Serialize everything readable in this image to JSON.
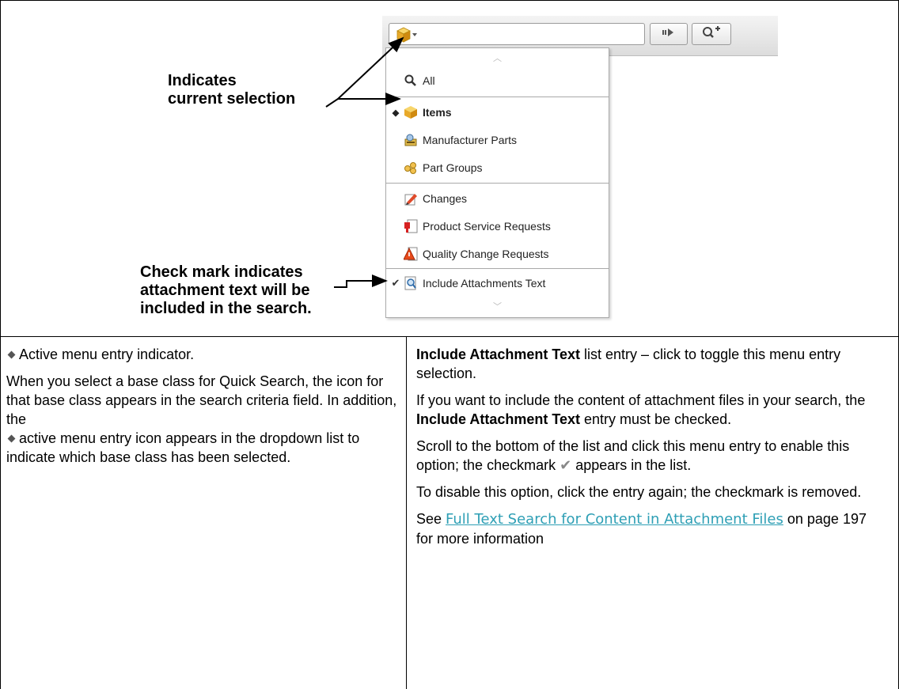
{
  "toolbar": {
    "class_selector_icon": "cube-icon",
    "go_icon": "arrow-right-icon",
    "advanced_search_icon": "search-plus-icon"
  },
  "dropdown": {
    "scroll_up": "^",
    "scroll_down": "v",
    "items": [
      {
        "label": "All",
        "icon": "search-icon",
        "active": false,
        "checked": false
      },
      {
        "label": "Items",
        "icon": "cube-icon",
        "active": true,
        "checked": false
      },
      {
        "label": "Manufacturer Parts",
        "icon": "manufacturer-part-icon",
        "active": false,
        "checked": false
      },
      {
        "label": "Part Groups",
        "icon": "part-group-icon",
        "active": false,
        "checked": false
      },
      {
        "label": "Changes",
        "icon": "change-icon",
        "active": false,
        "checked": false
      },
      {
        "label": "Product Service Requests",
        "icon": "psr-icon",
        "active": false,
        "checked": false
      },
      {
        "label": "Quality Change Requests",
        "icon": "qcr-icon",
        "active": false,
        "checked": false
      },
      {
        "label": "Include Attachments Text",
        "icon": "attachment-search-icon",
        "active": false,
        "checked": true
      }
    ],
    "active_marker": "◆",
    "check_marker": "✔"
  },
  "annotations": {
    "current_selection": [
      "Indicates",
      "current selection"
    ],
    "check_mark": [
      "Check mark indicates",
      "attachment text will be",
      "included in the search."
    ]
  },
  "left_cell": {
    "p1": "Active menu entry indicator.",
    "p2": "When you select a base class for Quick Search, the icon for that base class appears in the search criteria field. In addition, the",
    "p2_tail": "active menu entry icon appears in the dropdown list to indicate which base class has been selected."
  },
  "right_cell": {
    "p1_bold": "Include Attachment Text",
    "p1_rest": " list entry – click to toggle this menu entry selection.",
    "p2_start": "If you want to include the content of attachment files in your search, the ",
    "p2_bold": "Include Attachment Text",
    "p2_end": " entry must be checked.",
    "p3_start": "Scroll to the bottom of the list and click this menu entry to enable this option; the checkmark",
    "p3_end": "appears in the list.",
    "p4": "To disable this option, click the entry again; the checkmark is removed.",
    "p5_start": "See ",
    "p5_link": "Full Text Search for Content in Attachment Files",
    "p5_end": " on page 197 for more information"
  }
}
